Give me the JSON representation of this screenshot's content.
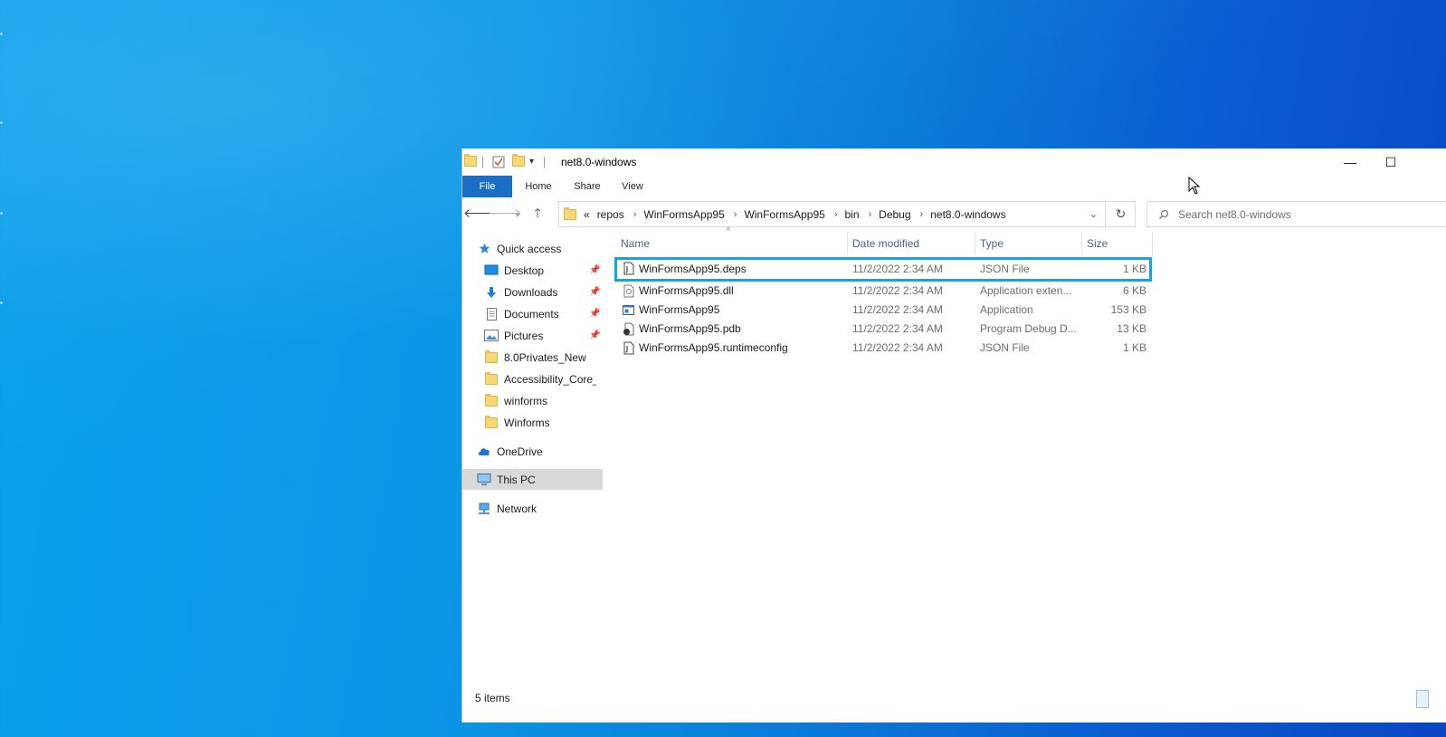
{
  "window": {
    "title": "net8.0-windows",
    "minimize_glyph": "—",
    "maximize_glyph": "☐"
  },
  "ribbon": {
    "tabs": [
      "File",
      "Home",
      "Share",
      "View"
    ]
  },
  "address": {
    "overflow": "«",
    "crumbs": [
      "repos",
      "WinFormsApp95",
      "WinFormsApp95",
      "bin",
      "Debug",
      "net8.0-windows"
    ],
    "search_placeholder": "Search net8.0-windows"
  },
  "nav": {
    "quick_access": "Quick access",
    "items": [
      {
        "label": "Desktop",
        "icon": "desktop-icon",
        "pinned": true
      },
      {
        "label": "Downloads",
        "icon": "downloads-icon",
        "pinned": true
      },
      {
        "label": "Documents",
        "icon": "documents-icon",
        "pinned": true
      },
      {
        "label": "Pictures",
        "icon": "pictures-icon",
        "pinned": true
      },
      {
        "label": "8.0Privates_New",
        "icon": "folder-icon",
        "pinned": false
      },
      {
        "label": "Accessibility_Core_A",
        "icon": "folder-icon",
        "pinned": false
      },
      {
        "label": "winforms",
        "icon": "folder-icon",
        "pinned": false
      },
      {
        "label": "Winforms",
        "icon": "folder-icon",
        "pinned": false
      }
    ],
    "onedrive": "OneDrive",
    "this_pc": "This PC",
    "network": "Network"
  },
  "columns": {
    "name": "Name",
    "date": "Date modified",
    "type": "Type",
    "size": "Size"
  },
  "files": [
    {
      "name": "WinFormsApp95.deps",
      "date": "11/2/2022 2:34 AM",
      "type": "JSON File",
      "size": "1 KB",
      "icon": "json-file-icon"
    },
    {
      "name": "WinFormsApp95.dll",
      "date": "11/2/2022 2:34 AM",
      "type": "Application exten...",
      "size": "6 KB",
      "icon": "dll-file-icon"
    },
    {
      "name": "WinFormsApp95",
      "date": "11/2/2022 2:34 AM",
      "type": "Application",
      "size": "153 KB",
      "icon": "exe-file-icon"
    },
    {
      "name": "WinFormsApp95.pdb",
      "date": "11/2/2022 2:34 AM",
      "type": "Program Debug D...",
      "size": "13 KB",
      "icon": "pdb-file-icon"
    },
    {
      "name": "WinFormsApp95.runtimeconfig",
      "date": "11/2/2022 2:34 AM",
      "type": "JSON File",
      "size": "1 KB",
      "icon": "json-file-icon"
    }
  ],
  "status": {
    "items_count": "5 items"
  },
  "colors": {
    "file_tab": "#1a6fc5",
    "highlight": "#13a5e0",
    "selected_nav": "#d9d9d9"
  }
}
